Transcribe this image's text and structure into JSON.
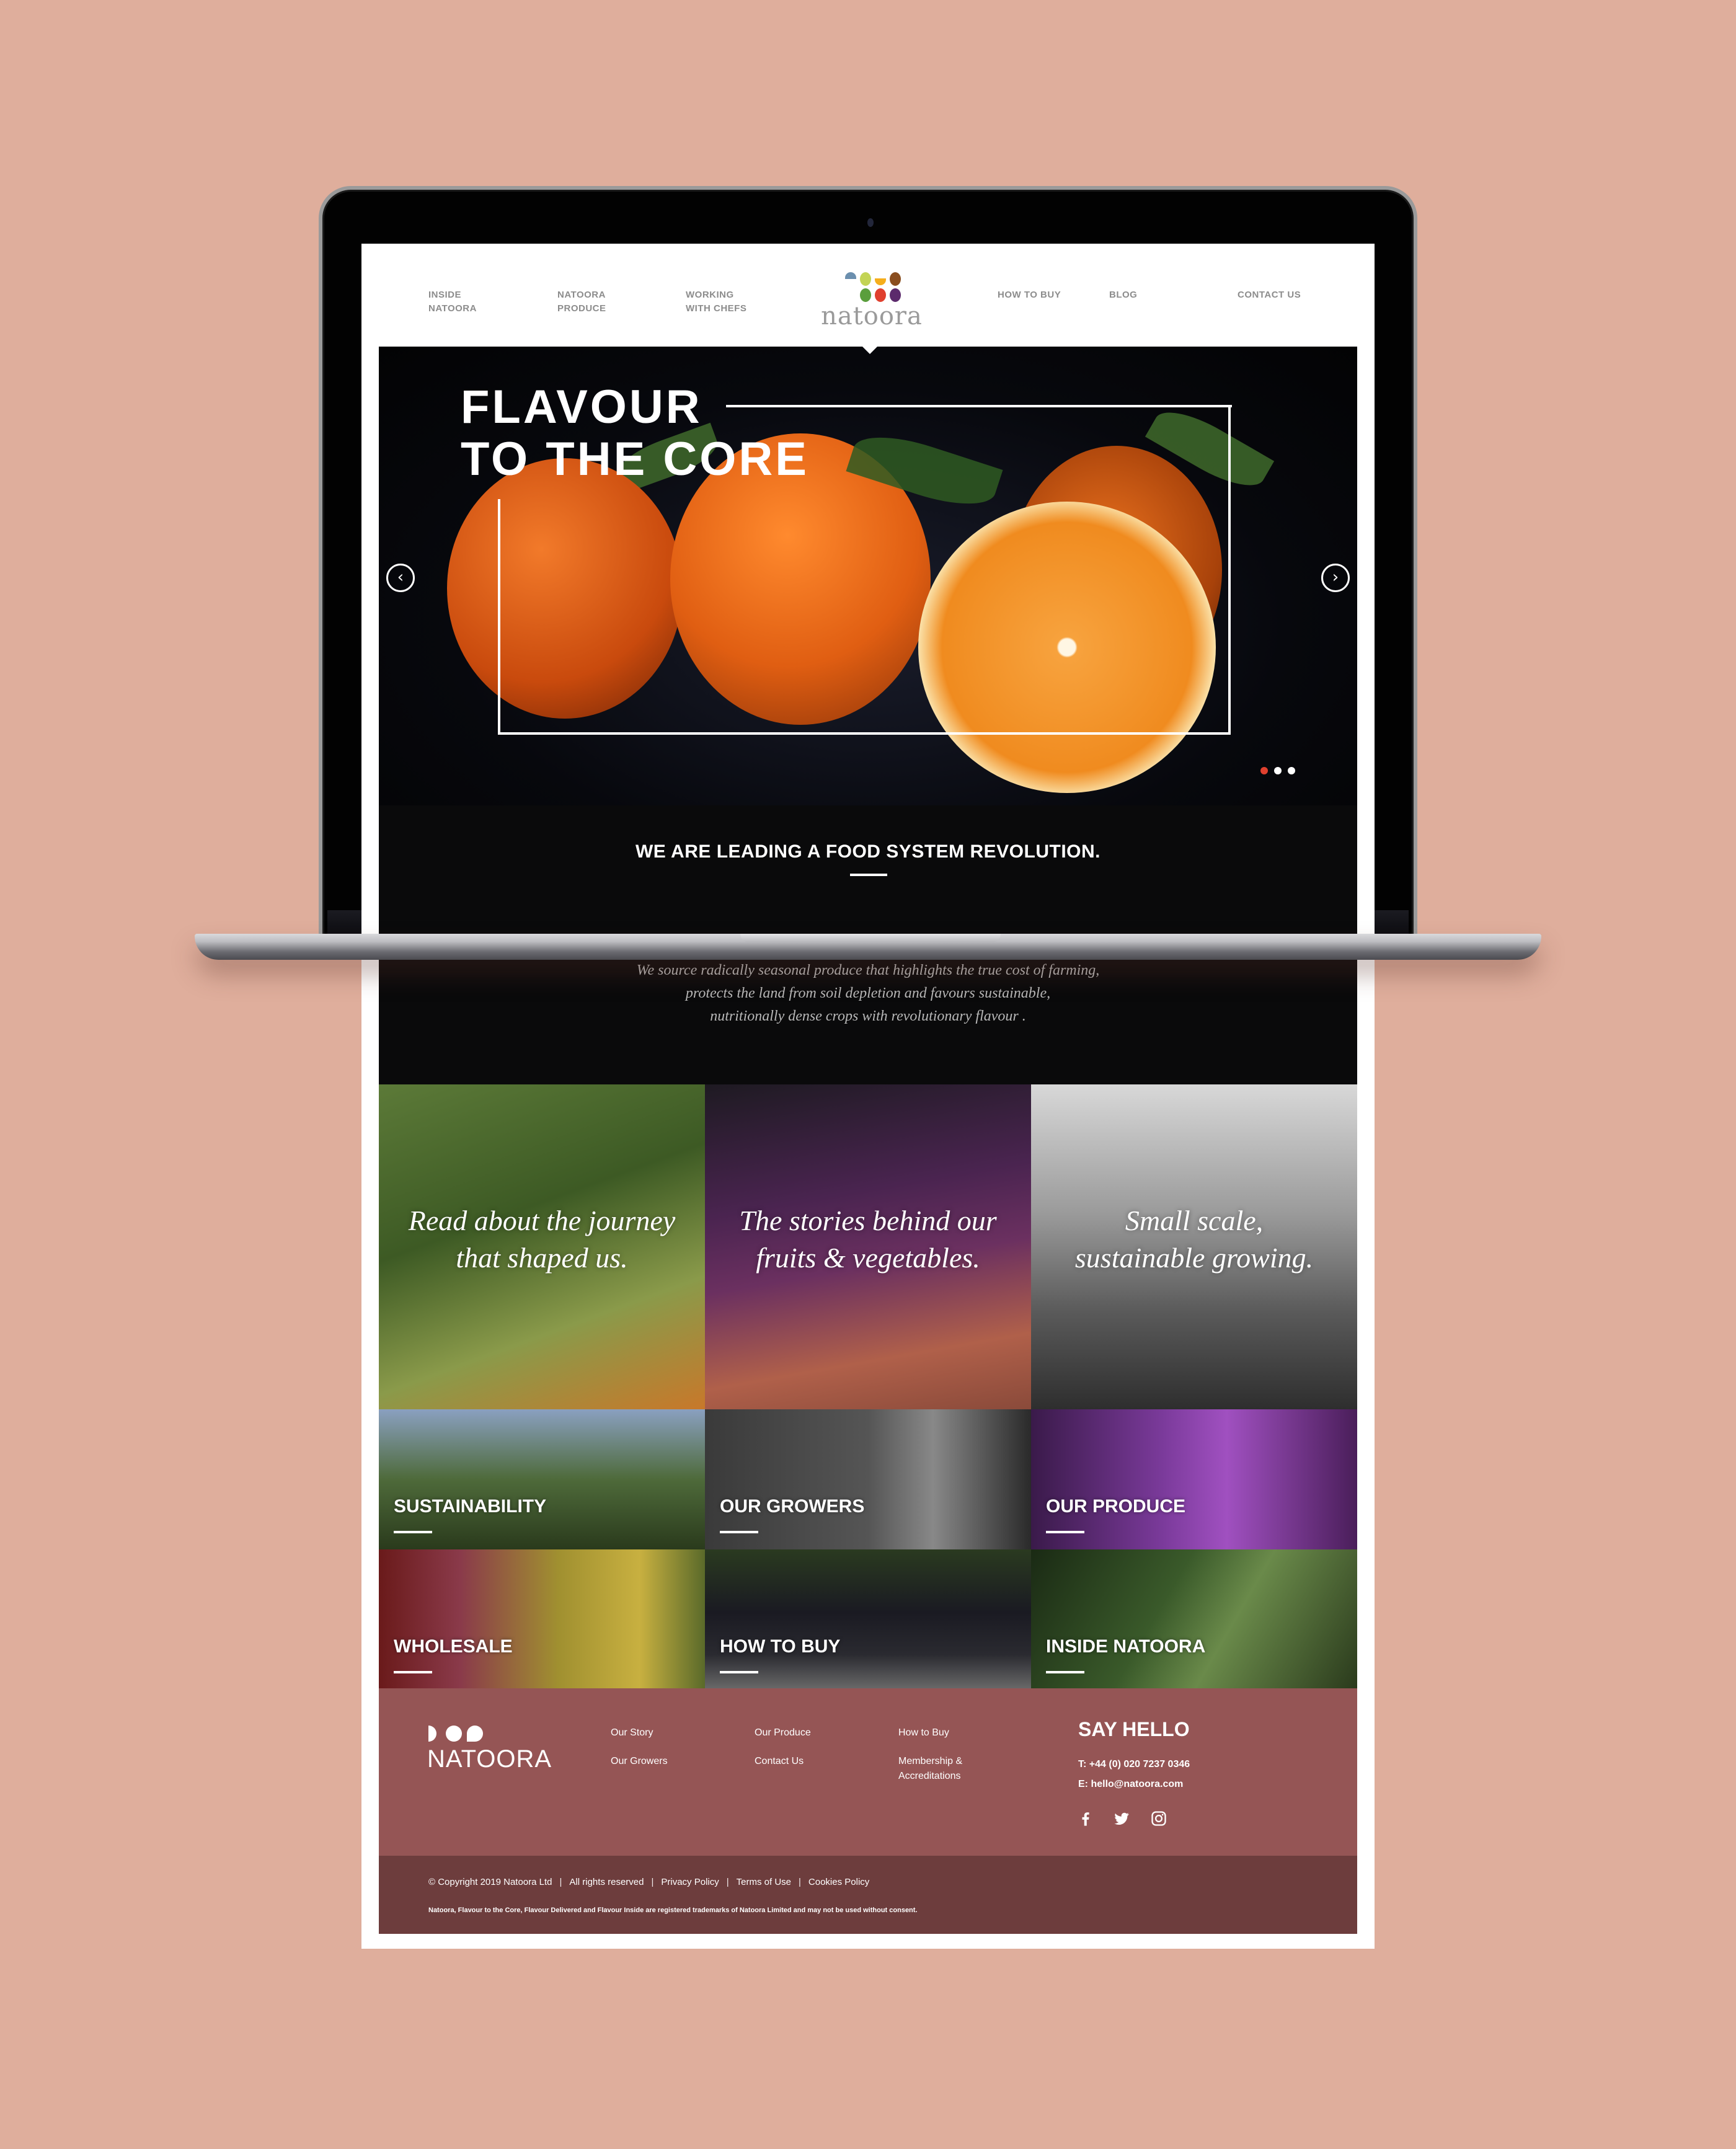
{
  "nav": {
    "items": [
      {
        "label_line1": "INSIDE",
        "label_line2": "NATOORA"
      },
      {
        "label_line1": "NATOORA",
        "label_line2": "PRODUCE"
      },
      {
        "label_line1": "WORKING",
        "label_line2": "WITH CHEFS"
      },
      {
        "label_line1": "HOW TO BUY",
        "label_line2": ""
      },
      {
        "label_line1": "BLOG",
        "label_line2": ""
      },
      {
        "label_line1": "CONTACT US",
        "label_line2": ""
      }
    ],
    "logo_text": "natoora",
    "logo_colors": [
      "#6b8fae",
      "#c3d455",
      "#f5ae1c",
      "#8a4e1f",
      "#5a9e3c",
      "#e0402e",
      "#5c2a6c"
    ]
  },
  "hero": {
    "title_line1": "FLAVOUR",
    "title_line2": "TO THE CORE",
    "prev_icon": "‹",
    "next_icon": "›",
    "slide_count": 3,
    "active_slide": 1,
    "dot_active_color": "#e0402e",
    "dot_color": "#ffffff"
  },
  "mission": {
    "title": "WE ARE LEADING A FOOD SYSTEM REVOLUTION.",
    "text_line1": "We source radically seasonal produce that highlights the true cost of farming,",
    "text_line2": "protects the land from soil depletion and favours sustainable,",
    "text_line3": "nutritionally dense crops with revolutionary flavour ."
  },
  "feature_tiles": [
    {
      "line1": "Read about the journey",
      "line2": "that shaped us."
    },
    {
      "line1": "The stories behind our",
      "line2": "fruits & vegetables."
    },
    {
      "line1": "Small scale,",
      "line2": "sustainable growing."
    }
  ],
  "section_tiles": [
    {
      "label": "SUSTAINABILITY"
    },
    {
      "label": "OUR GROWERS"
    },
    {
      "label": "OUR PRODUCE"
    },
    {
      "label": "WHOLESALE"
    },
    {
      "label": "HOW TO BUY"
    },
    {
      "label": "INSIDE NATOORA"
    }
  ],
  "footer": {
    "logo_text": "NATOORA",
    "links": {
      "our_story": "Our Story",
      "our_growers": "Our Growers",
      "our_produce": "Our Produce",
      "contact_us": "Contact Us",
      "how_to_buy": "How to Buy",
      "membership_line1": "Membership &",
      "membership_line2": "Accreditations"
    },
    "say_hello": "SAY HELLO",
    "phone": "T: +44 (0) 020 7237 0346",
    "email": "E: hello@natoora.com",
    "social": [
      "facebook",
      "twitter",
      "instagram"
    ],
    "copyright": "© Copyright 2019 Natoora Ltd",
    "rights": "All rights reserved",
    "privacy": "Privacy Policy",
    "terms": "Terms of Use",
    "cookies": "Cookies Policy",
    "separator": "|",
    "trademark": "Natoora, Flavour to the Core, Flavour Delivered and Flavour Inside are registered trademarks of Natoora Limited and may not be used without consent.",
    "bg_color": "#955555",
    "bottom_color": "#6d3d3d"
  },
  "background_color": "#dfae9c"
}
